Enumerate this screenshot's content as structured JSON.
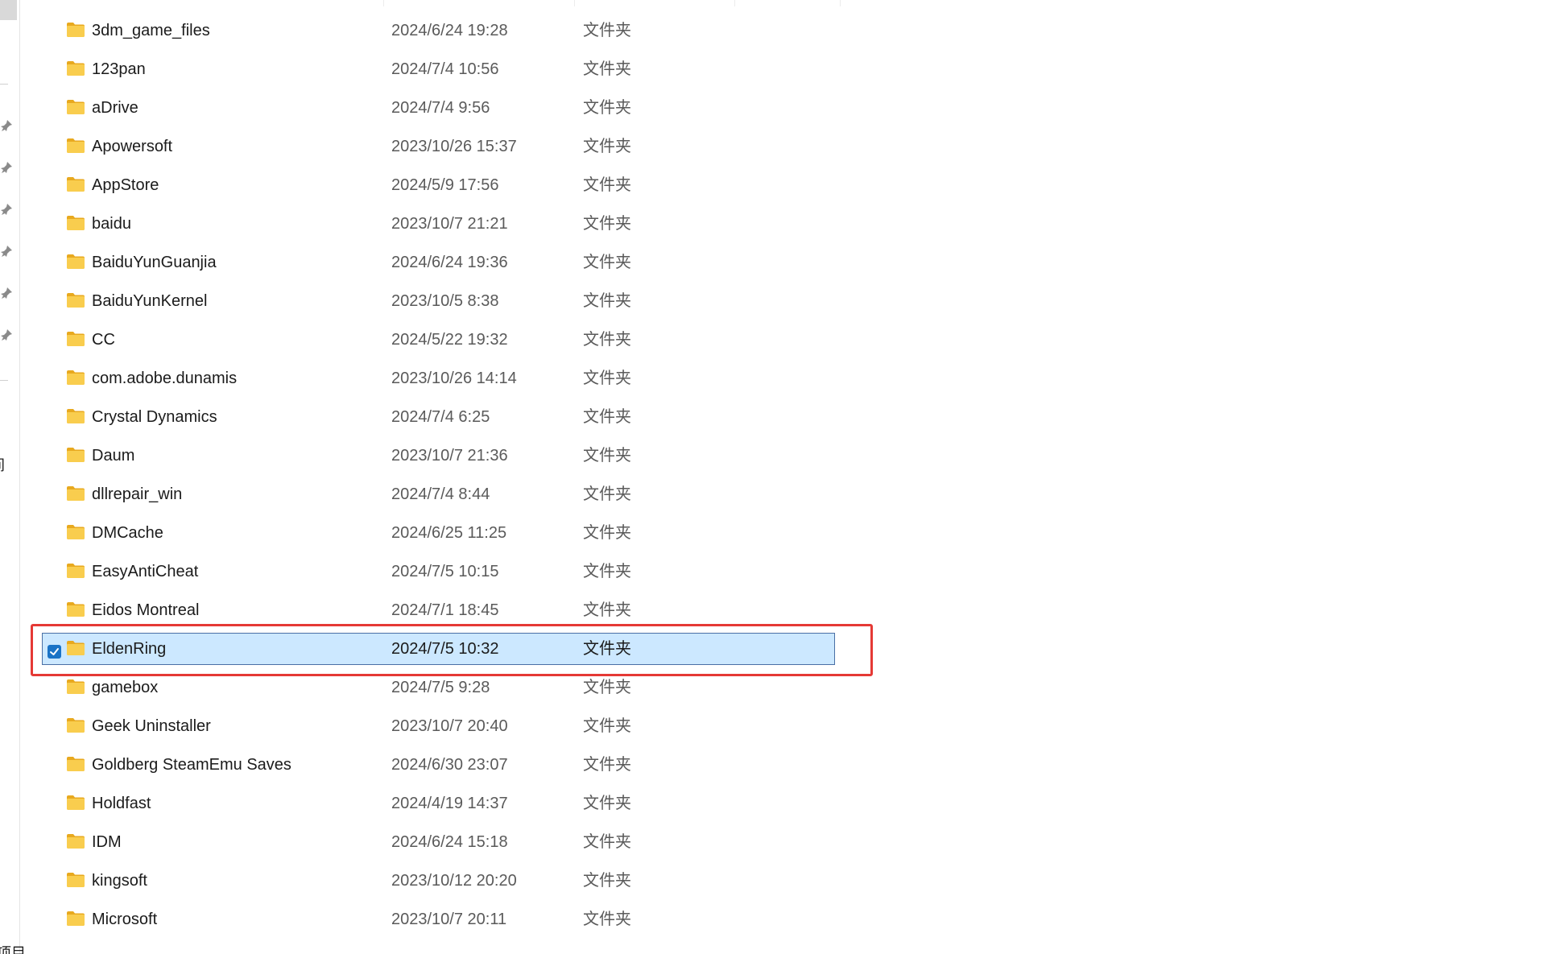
{
  "nav": {
    "partial_text_1": "间",
    "partial_text_2": "项目"
  },
  "files": [
    {
      "name": "3dm_game_files",
      "date": "2024/6/24 19:28",
      "type": "文件夹",
      "selected": false
    },
    {
      "name": "123pan",
      "date": "2024/7/4 10:56",
      "type": "文件夹",
      "selected": false
    },
    {
      "name": "aDrive",
      "date": "2024/7/4 9:56",
      "type": "文件夹",
      "selected": false
    },
    {
      "name": "Apowersoft",
      "date": "2023/10/26 15:37",
      "type": "文件夹",
      "selected": false
    },
    {
      "name": "AppStore",
      "date": "2024/5/9 17:56",
      "type": "文件夹",
      "selected": false
    },
    {
      "name": "baidu",
      "date": "2023/10/7 21:21",
      "type": "文件夹",
      "selected": false
    },
    {
      "name": "BaiduYunGuanjia",
      "date": "2024/6/24 19:36",
      "type": "文件夹",
      "selected": false
    },
    {
      "name": "BaiduYunKernel",
      "date": "2023/10/5 8:38",
      "type": "文件夹",
      "selected": false
    },
    {
      "name": "CC",
      "date": "2024/5/22 19:32",
      "type": "文件夹",
      "selected": false
    },
    {
      "name": "com.adobe.dunamis",
      "date": "2023/10/26 14:14",
      "type": "文件夹",
      "selected": false
    },
    {
      "name": "Crystal Dynamics",
      "date": "2024/7/4 6:25",
      "type": "文件夹",
      "selected": false
    },
    {
      "name": "Daum",
      "date": "2023/10/7 21:36",
      "type": "文件夹",
      "selected": false
    },
    {
      "name": "dllrepair_win",
      "date": "2024/7/4 8:44",
      "type": "文件夹",
      "selected": false
    },
    {
      "name": "DMCache",
      "date": "2024/6/25 11:25",
      "type": "文件夹",
      "selected": false
    },
    {
      "name": "EasyAntiCheat",
      "date": "2024/7/5 10:15",
      "type": "文件夹",
      "selected": false
    },
    {
      "name": "Eidos Montreal",
      "date": "2024/7/1 18:45",
      "type": "文件夹",
      "selected": false
    },
    {
      "name": "EldenRing",
      "date": "2024/7/5 10:32",
      "type": "文件夹",
      "selected": true
    },
    {
      "name": "gamebox",
      "date": "2024/7/5 9:28",
      "type": "文件夹",
      "selected": false
    },
    {
      "name": "Geek Uninstaller",
      "date": "2023/10/7 20:40",
      "type": "文件夹",
      "selected": false
    },
    {
      "name": "Goldberg SteamEmu Saves",
      "date": "2024/6/30 23:07",
      "type": "文件夹",
      "selected": false
    },
    {
      "name": "Holdfast",
      "date": "2024/4/19 14:37",
      "type": "文件夹",
      "selected": false
    },
    {
      "name": "IDM",
      "date": "2024/6/24 15:18",
      "type": "文件夹",
      "selected": false
    },
    {
      "name": "kingsoft",
      "date": "2023/10/12 20:20",
      "type": "文件夹",
      "selected": false
    },
    {
      "name": "Microsoft",
      "date": "2023/10/7 20:11",
      "type": "文件夹",
      "selected": false
    }
  ],
  "colors": {
    "selection_bg": "#cce8ff",
    "annotation_border": "#e53935",
    "folder_yellow": "#f7c948",
    "checkbox_blue": "#1a73c6"
  }
}
